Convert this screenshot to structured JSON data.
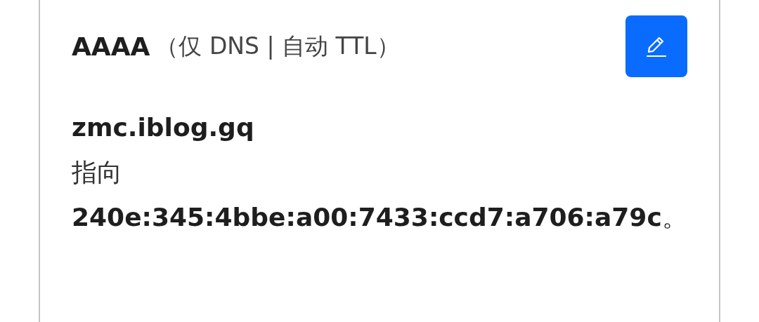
{
  "record": {
    "type": "AAAA",
    "meta": "（仅 DNS | 自动 TTL）",
    "name": "zmc.iblog.gq",
    "verb": "指向",
    "content": "**240e:345:4bbe:a00:7433:ccd7:a706:a79c**。"
  }
}
